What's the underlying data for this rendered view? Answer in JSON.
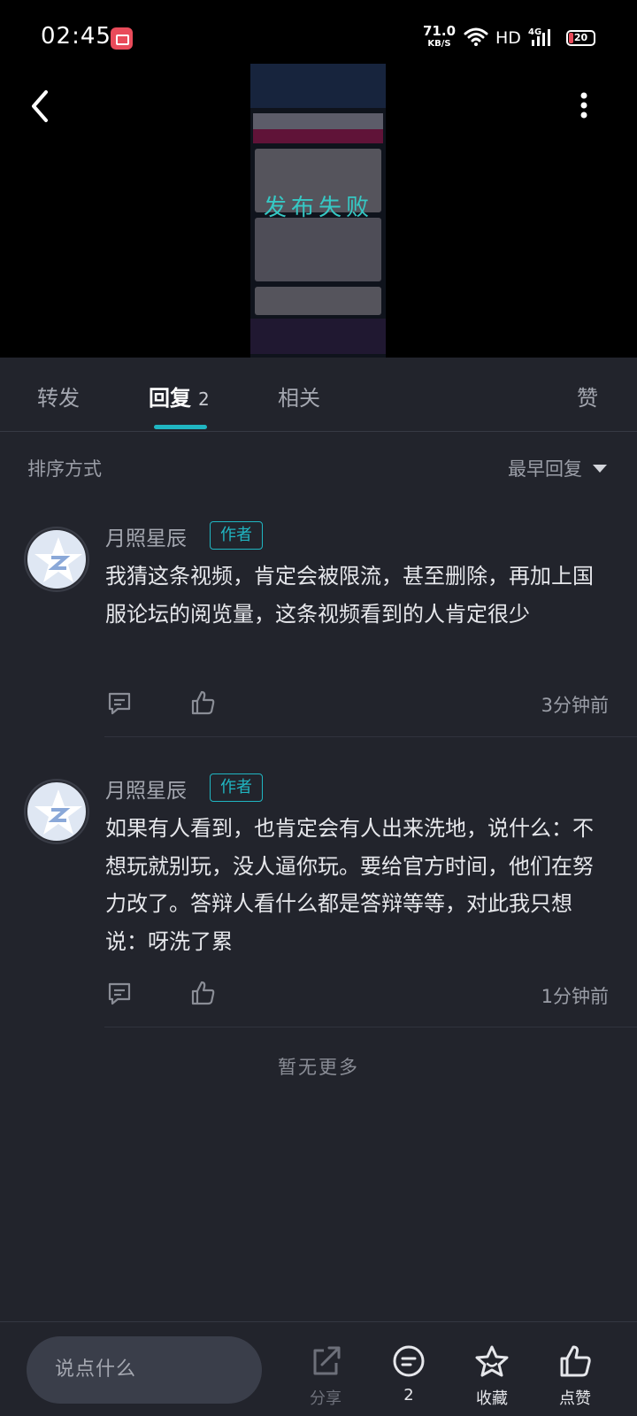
{
  "status_bar": {
    "time": "02:45",
    "net_speed_value": "71.0",
    "net_speed_unit": "KB/S",
    "hd": "HD",
    "network": "4G",
    "battery": "20"
  },
  "video": {
    "overlay_text": "发布失败"
  },
  "tabs": [
    {
      "label": "转发"
    },
    {
      "label": "回复",
      "count": "2"
    },
    {
      "label": "相关"
    },
    {
      "label": "赞"
    }
  ],
  "sort": {
    "label": "排序方式",
    "selected": "最早回复"
  },
  "comments": [
    {
      "author": "月照星辰",
      "badge": "作者",
      "text": "我猜这条视频，肯定会被限流，甚至删除，再加上国服论坛的阅览量，这条视频看到的人肯定很少",
      "time": "3分钟前"
    },
    {
      "author": "月照星辰",
      "badge": "作者",
      "text": "如果有人看到，也肯定会有人出来洗地，说什么：不想玩就别玩，没人逼你玩。要给官方时间，他们在努力改了。答辩人看什么都是答辩等等，对此我只想说：呀洗了累",
      "time": "1分钟前"
    }
  ],
  "no_more": "暂无更多",
  "bottom_bar": {
    "input_placeholder": "说点什么",
    "share_label": "分享",
    "comment_count": "2",
    "favorite_label": "收藏",
    "like_label": "点赞"
  },
  "colors": {
    "accent": "#20b6c2",
    "background": "#22242c",
    "overlay_text": "#36c8c4"
  }
}
